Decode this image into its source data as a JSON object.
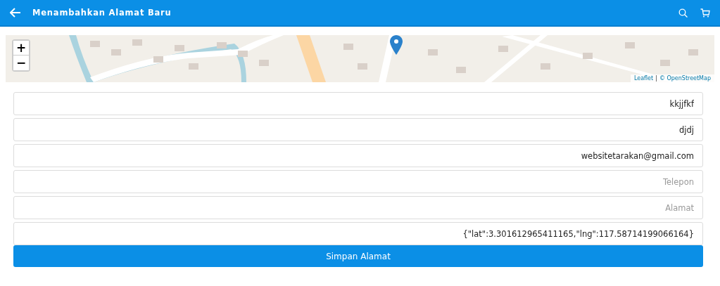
{
  "header": {
    "title": "Menambahkan Alamat Baru"
  },
  "map": {
    "kind": "picture",
    "zoom_in": "+",
    "zoom_out": "−",
    "attribution": {
      "leaflet": "Leaflet",
      "separator": "|",
      "osm": "© OpenStreetMap"
    }
  },
  "fields": [
    {
      "value": "kkjjfkf"
    },
    {
      "value": "djdj"
    },
    {
      "value": "websitetarakan@gmail.com"
    },
    {
      "placeholder": "Telepon"
    },
    {
      "placeholder": "Alamat"
    },
    {
      "value": "{\"lat\":3.301612965411165,\"lng\":117.58714199066164}"
    }
  ],
  "submit": {
    "label": "Simpan Alamat"
  }
}
